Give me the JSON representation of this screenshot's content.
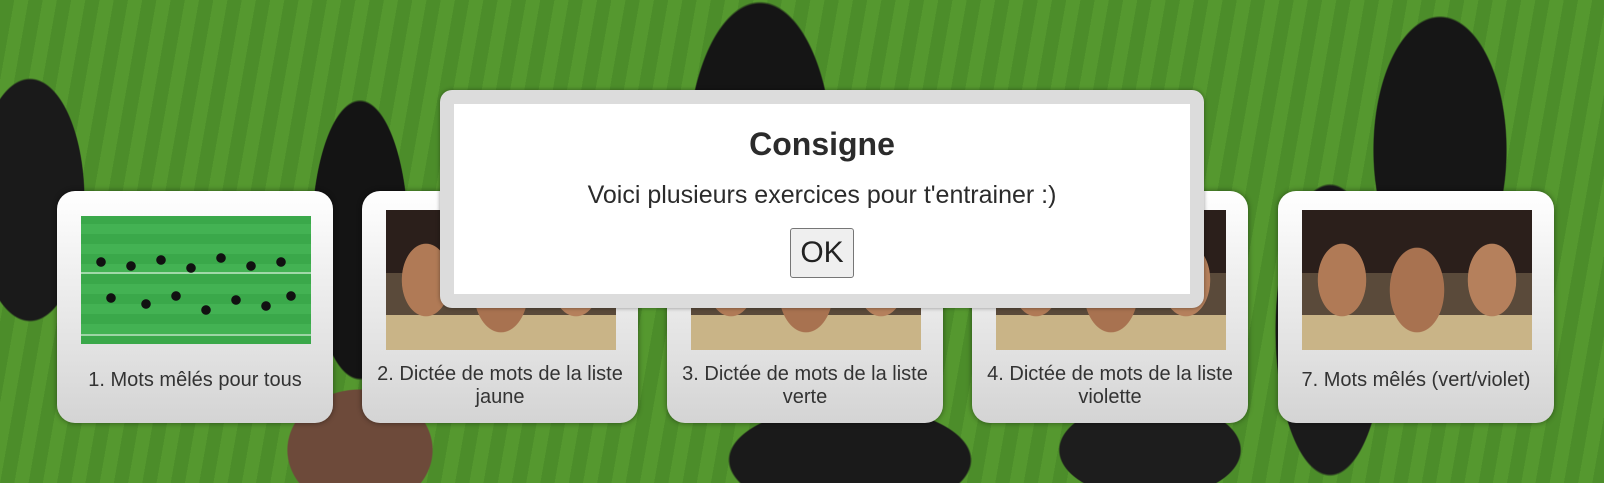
{
  "modal": {
    "title": "Consigne",
    "message": "Voici plusieurs exercices pour t'entrainer :)",
    "ok_label": "OK"
  },
  "cards": [
    {
      "label": "1. Mots mêlés pour tous",
      "image": "haka-field-photo"
    },
    {
      "label": "2. Dictée de mots de la liste jaune",
      "image": "haka-group-photo"
    },
    {
      "label": "3. Dictée de mots de la liste verte",
      "image": "haka-group-photo"
    },
    {
      "label": "4. Dictée de mots de la liste violette",
      "image": "haka-group-photo"
    },
    {
      "label": "7. Mots mêlés (vert/violet)",
      "image": "haka-group-photo"
    }
  ],
  "colors": {
    "background_grass": "#4e8e2c",
    "card_top": "#ffffff",
    "card_bottom": "#d4d4d4",
    "modal_frame": "#dcdcdc"
  }
}
